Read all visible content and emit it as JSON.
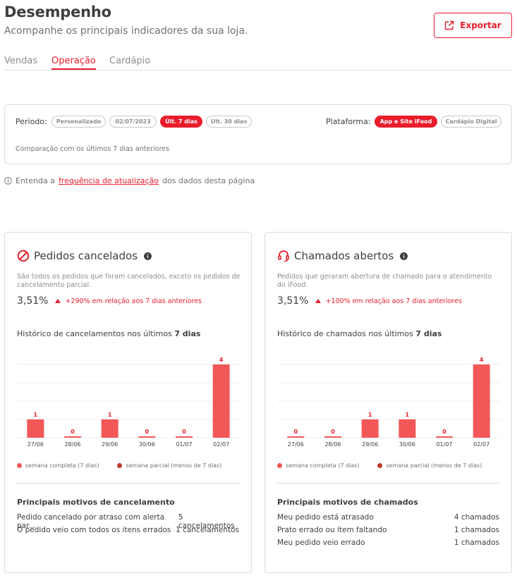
{
  "header": {
    "title": "Desempenho",
    "subtitle": "Acompanhe os principais indicadores da sua loja.",
    "export_label": "Exportar"
  },
  "tabs": [
    {
      "label": "Vendas",
      "active": false
    },
    {
      "label": "Operação",
      "active": true
    },
    {
      "label": "Cardápio",
      "active": false
    }
  ],
  "filters": {
    "period_label": "Período:",
    "period_options": [
      {
        "label": "Personalizado",
        "active": false
      },
      {
        "label": "02/07/2023",
        "active": false
      },
      {
        "label": "Últ. 7 dias",
        "active": true
      },
      {
        "label": "Últ. 30 dias",
        "active": false
      }
    ],
    "platform_label": "Plataforma:",
    "platform_options": [
      {
        "label": "App e Site iFood",
        "active": true
      },
      {
        "label": "Cardápio Digital",
        "active": false
      }
    ],
    "comparison_text": "Comparação com os últimos 7 dias anteriores"
  },
  "info": {
    "prefix": "Entenda a",
    "link": "frequência de atualização",
    "suffix": "dos dados desta página"
  },
  "colors": {
    "accent": "#ea1d2c",
    "bar_full_week": "#f25858",
    "bar_partial_week": "#c0392b"
  },
  "cards": [
    {
      "icon": "prohibited-icon",
      "title": "Pedidos cancelados",
      "description": "São todos os pedidos que foram cancelados, exceto os pedidos de cancelamento parcial.",
      "value": "3,51%",
      "delta": "+290% em relação aos 7 dias anteriores",
      "history_prefix": "Histórico de cancelamentos nos últimos",
      "history_bold": "7 dias",
      "legend_full": "semana completa (7 dias)",
      "legend_partial": "semana parcial (menos de 7 dias)",
      "reasons_title": "Principais motivos de cancelamento",
      "reasons": [
        {
          "label": "Pedido cancelado por atraso com alerta par...",
          "value": "5 cancelamentos"
        },
        {
          "label": "O pedido veio com todos os itens errados",
          "value": "1 cancelamentos"
        }
      ],
      "chart_data": {
        "type": "bar",
        "categories": [
          "27/06",
          "28/06",
          "29/06",
          "30/06",
          "01/07",
          "02/07"
        ],
        "values": [
          1,
          0,
          1,
          0,
          0,
          4
        ],
        "ylim": [
          0,
          4
        ],
        "grid": true
      }
    },
    {
      "icon": "headset-icon",
      "title": "Chamados abertos",
      "description": "Pedidos que geraram abertura de chamado para o atendimento do iFood.",
      "value": "3,51%",
      "delta": "+100% em relação aos 7 dias anteriores",
      "history_prefix": "Histórico de chamados nos últimos",
      "history_bold": "7 dias",
      "legend_full": "semana completa (7 dias)",
      "legend_partial": "semana parcial (menos de 7 dias)",
      "reasons_title": "Principais motivos de chamados",
      "reasons": [
        {
          "label": "Meu pedido está atrasado",
          "value": "4 chamados"
        },
        {
          "label": "Prato errado ou item faltando",
          "value": "1 chamados"
        },
        {
          "label": "Meu pedido veio errado",
          "value": "1 chamados"
        }
      ],
      "chart_data": {
        "type": "bar",
        "categories": [
          "27/06",
          "28/06",
          "29/06",
          "30/06",
          "01/07",
          "02/07"
        ],
        "values": [
          0,
          0,
          1,
          1,
          0,
          4
        ],
        "ylim": [
          0,
          4
        ],
        "grid": true
      }
    }
  ]
}
